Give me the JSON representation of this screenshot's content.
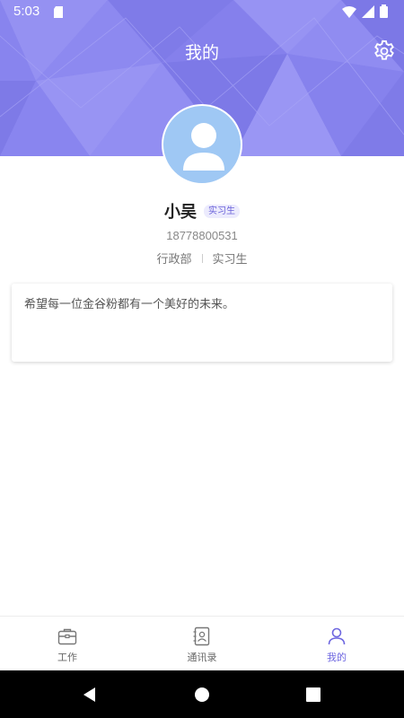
{
  "status_bar": {
    "time": "5:03"
  },
  "header": {
    "title": "我的",
    "settings_icon": "gear-icon",
    "bg_color": "#8a86ee"
  },
  "profile": {
    "name": "小吴",
    "badge": "实习生",
    "phone": "18778800531",
    "department": "行政部",
    "role": "实习生"
  },
  "motto": "希望每一位金谷粉都有一个美好的未来。",
  "tabbar": {
    "accent_color": "#6e67e0",
    "tabs": [
      {
        "label": "工作",
        "icon": "briefcase-icon"
      },
      {
        "label": "通讯录",
        "icon": "contacts-icon"
      },
      {
        "label": "我的",
        "icon": "person-icon",
        "active": true
      }
    ]
  },
  "system_nav": {
    "buttons": [
      "back-icon",
      "home-icon",
      "recents-icon"
    ]
  }
}
